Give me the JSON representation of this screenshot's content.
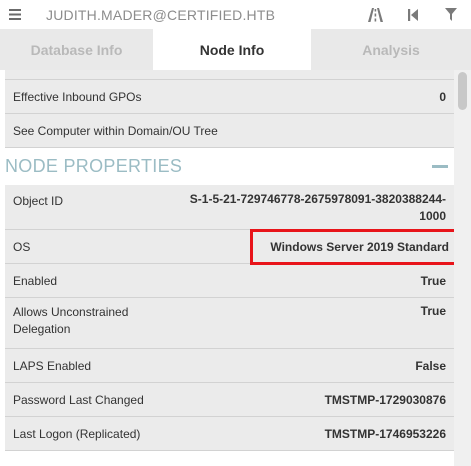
{
  "topbar": {
    "user": "JUDITH.MADER@CERTIFIED.HTB",
    "icons": [
      "menu-icon",
      "pathfinding-icon",
      "back-icon",
      "filter-icon"
    ]
  },
  "tabs": [
    {
      "label": "Database Info",
      "active": false
    },
    {
      "label": "Node Info",
      "active": true
    },
    {
      "label": "Analysis",
      "active": false
    }
  ],
  "rows_top": [
    {
      "key": "Effective Inbound GPOs",
      "value": "0"
    },
    {
      "key": "See Computer within Domain/OU Tree",
      "value": ""
    }
  ],
  "node_properties": {
    "title": "NODE PROPERTIES",
    "rows": [
      {
        "key": "Object ID",
        "value": "S-1-5-21-729746778-2675978091-3820388244-1000"
      },
      {
        "key": "OS",
        "value": "Windows Server 2019 Standard",
        "highlighted": true
      },
      {
        "key": "Enabled",
        "value": "True"
      },
      {
        "key": "Allows Unconstrained Delegation",
        "value": "True"
      },
      {
        "key": "LAPS Enabled",
        "value": "False"
      },
      {
        "key": "Password Last Changed",
        "value": "TMSTMP-1729030876"
      },
      {
        "key": "Last Logon (Replicated)",
        "value": "TMSTMP-1746953226"
      }
    ]
  },
  "colors": {
    "highlight": "#e8141a",
    "section_title": "#9bbcc4",
    "row_bg": "#ebebeb"
  }
}
